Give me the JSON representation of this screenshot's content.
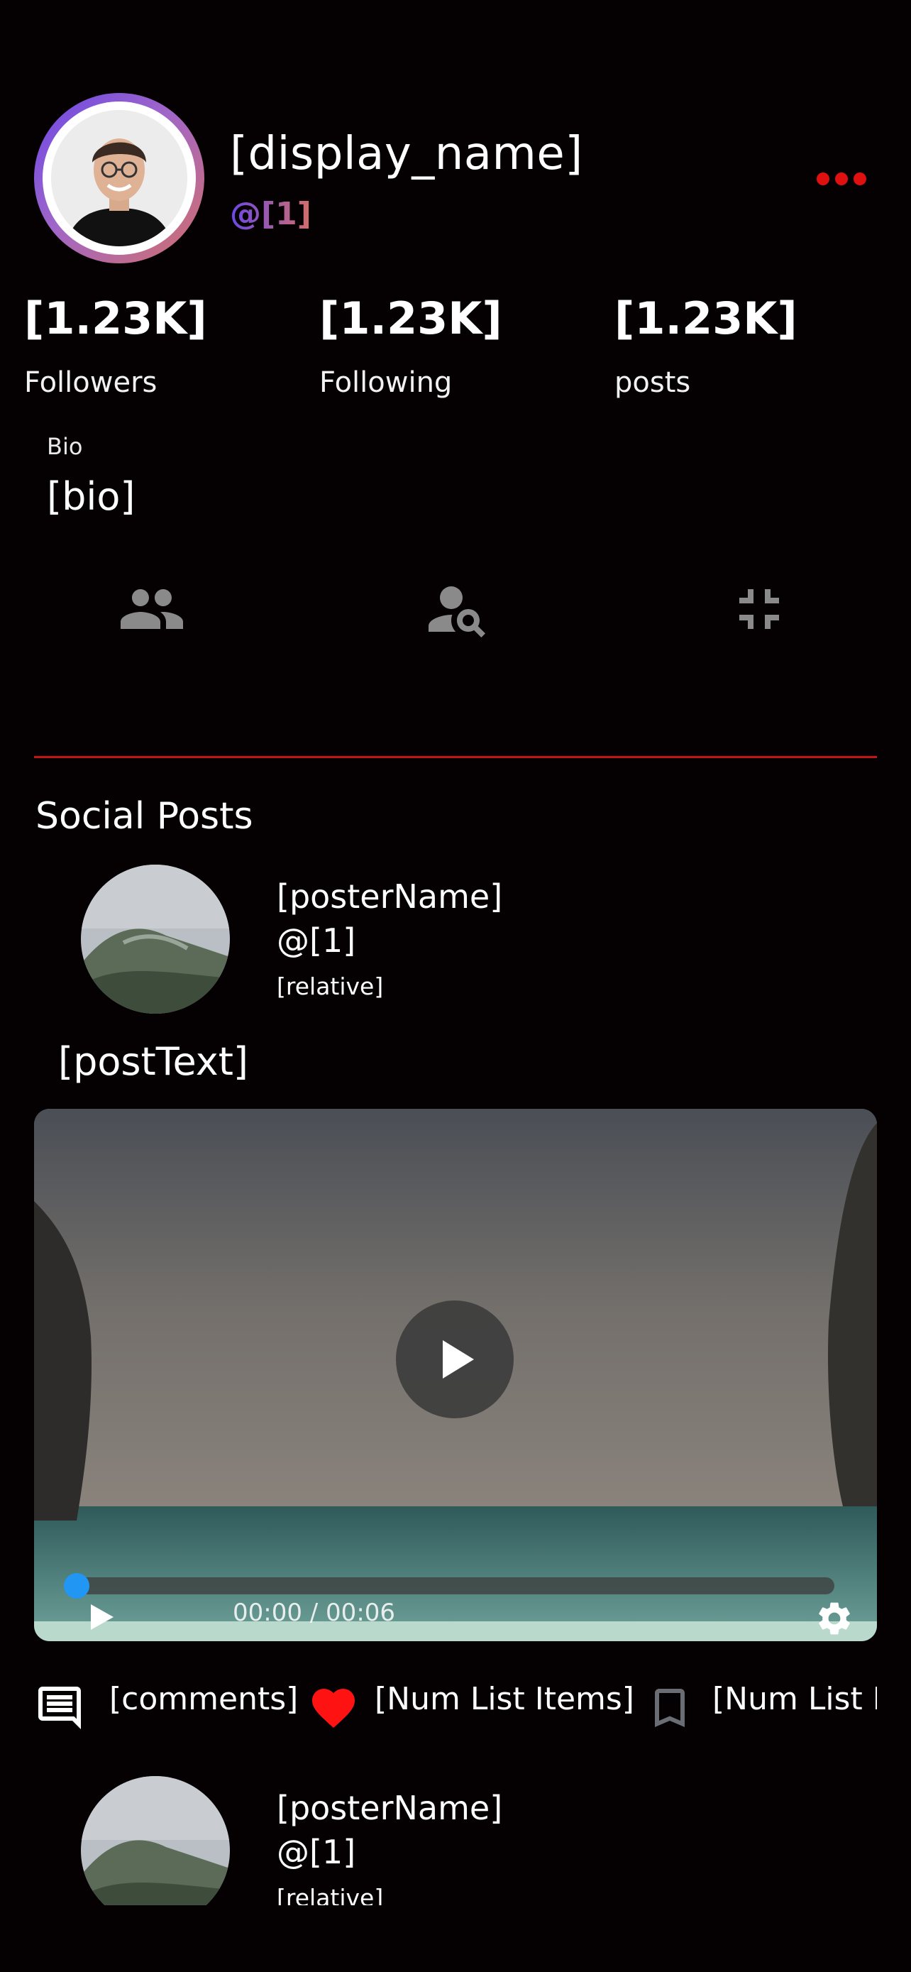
{
  "profile": {
    "display_name": "[display_name]",
    "handle": "@[1]",
    "more_icon": "more-horizontal-icon",
    "accent_color": "#e01010"
  },
  "stats": [
    {
      "value": "[1.23K]",
      "label": "Followers"
    },
    {
      "value": "[1.23K]",
      "label": "Following"
    },
    {
      "value": "[1.23K]",
      "label": "posts"
    }
  ],
  "bio": {
    "label": "Bio",
    "value": "[bio]"
  },
  "actions": [
    {
      "icon": "people-icon"
    },
    {
      "icon": "person-search-icon"
    },
    {
      "icon": "collapse-icon"
    }
  ],
  "section": {
    "title": "Social Posts"
  },
  "posts": [
    {
      "poster_name": "[posterName]",
      "handle": "@[1]",
      "relative": "[relative]",
      "text": "[postText]",
      "video": {
        "progress": 0,
        "time": "00:00 / 00:06"
      },
      "comments": "[comments]",
      "likes": "[Num List Items]",
      "saves": "[Num List I"
    },
    {
      "poster_name": "[posterName]",
      "handle": "@[1]",
      "relative": "[relative]"
    }
  ]
}
